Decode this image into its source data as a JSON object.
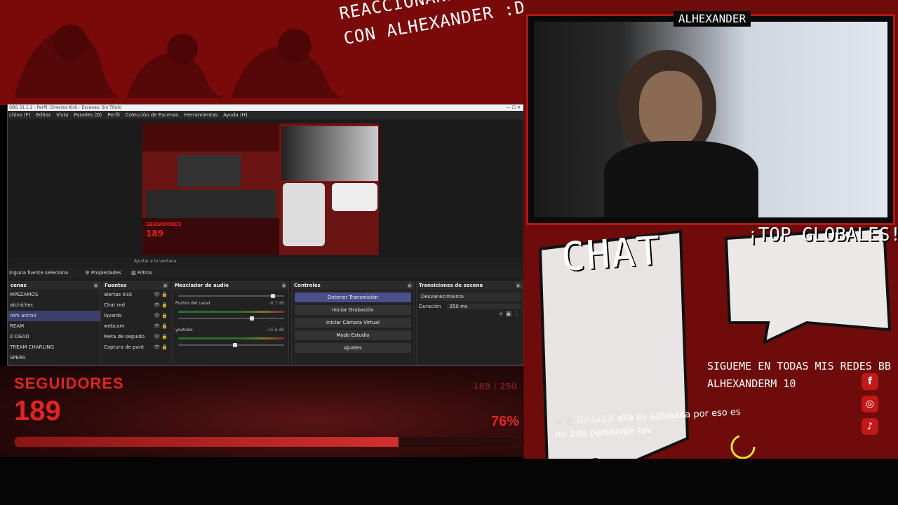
{
  "stream": {
    "title_line1": "REACCIONANDO ANDO",
    "title_line2": "CON ALHEXANDER :D",
    "cam_label": "ALHEXANDER"
  },
  "obs": {
    "titlebar": "OBS 31.1.2 - Perfil: Directos Kick - Escenas: Sin Título",
    "menu": [
      "chivo (F)",
      "Editar",
      "Vista",
      "Paneles (D)",
      "Perfil",
      "Colección de Escenas",
      "Herramientas",
      "Ayuda (H)"
    ],
    "toolbar": {
      "zoom": "Ajustar a la ventana"
    },
    "source_row": {
      "no_source": "inguna fuente seleciona",
      "properties": "Propiedades",
      "filters": "Filtros"
    },
    "scenes": {
      "header": "cenas",
      "items": [
        "MPEZAMOS",
        "atchichec",
        "rem anime",
        "REAM",
        "D DEAD",
        "TREAM CHARLING",
        "SPERA"
      ],
      "selected_index": 2
    },
    "sources": {
      "header": "Fuentes",
      "items": [
        "alertas kick",
        "Chat red",
        "layards",
        "webcam",
        "Meta de seguido",
        "Captura de pant"
      ]
    },
    "mixer": {
      "header": "Mezclador de audio",
      "channels": [
        {
          "name": "Puntos del canal",
          "db": "-6.7 dB"
        },
        {
          "name": "youtube",
          "db": "-15.6 dB"
        }
      ]
    },
    "controls": {
      "header": "Controles",
      "buttons": [
        "Detener Transmisión",
        "Iniciar Grabación",
        "Iniciar Cámara Virtual",
        "Modo Estudio",
        "Ajustes"
      ]
    },
    "transitions": {
      "header": "Transiciones de escena",
      "selected": "Desvanecimiento",
      "duration_label": "Duración",
      "duration_value": "350 ms"
    }
  },
  "followers": {
    "title": "SEGUIDORES",
    "count": "189",
    "goal": "189 / 250",
    "percent_label": "76%",
    "progress": 0.76
  },
  "overlay": {
    "chat_title": "CHAT",
    "top_title": "¡TOP GLOBALES!",
    "social_line1": "SIGUEME EN TODAS MIS REDES BB",
    "social_line2": "ALHEXANDERM 10"
  },
  "chat_message": {
    "user": "Drilu19",
    "text": "ella es sabiaaaa por eso es mi 2do personaje fav"
  },
  "colors": {
    "accent": "#c21818",
    "bg_red": "#6e0b0b"
  }
}
